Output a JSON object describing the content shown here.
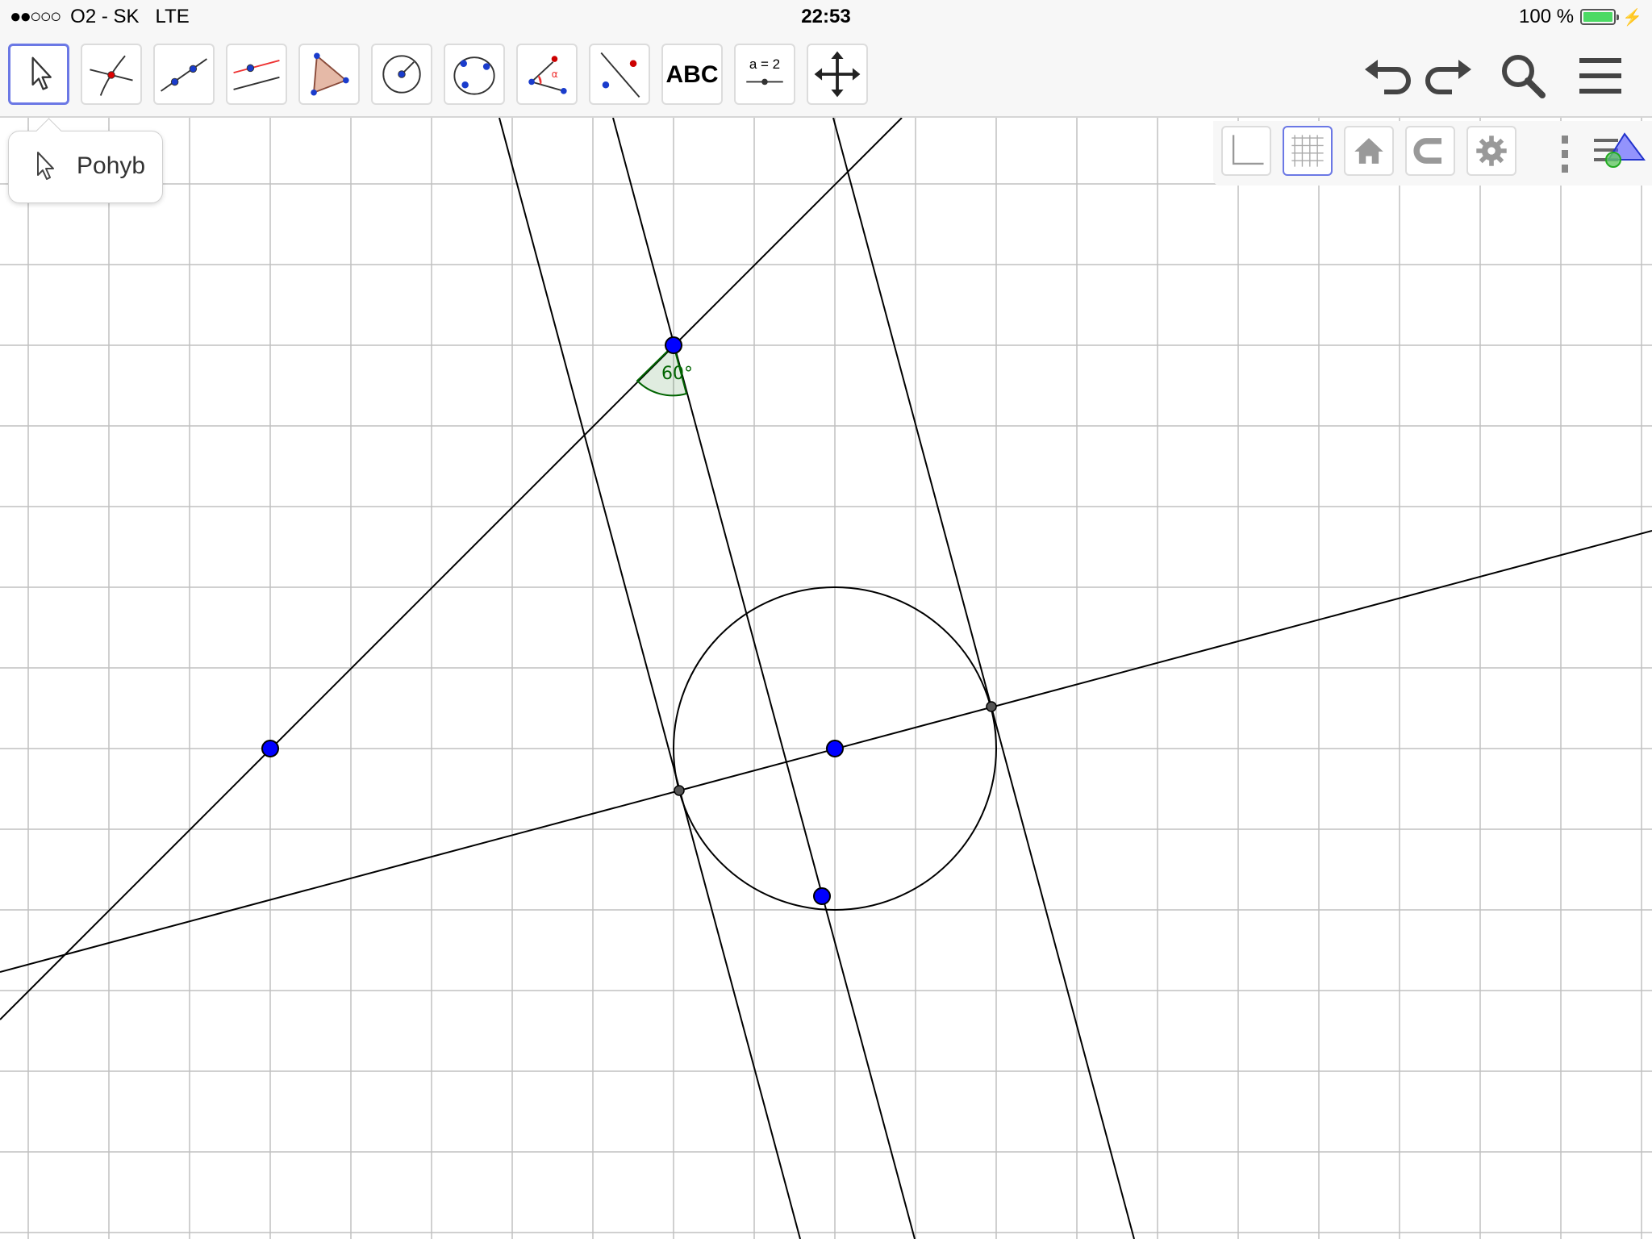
{
  "status_bar": {
    "carrier": "O2 - SK",
    "network": "LTE",
    "time": "22:53",
    "battery": "100 %"
  },
  "toolbar": {
    "tools": [
      {
        "id": "move",
        "icon": "move-arrow-icon",
        "active": true
      },
      {
        "id": "point",
        "icon": "point-on-intersection-icon"
      },
      {
        "id": "line",
        "icon": "line-through-points-icon"
      },
      {
        "id": "parallel",
        "icon": "parallel-line-icon"
      },
      {
        "id": "polygon",
        "icon": "polygon-icon"
      },
      {
        "id": "circle",
        "icon": "circle-center-point-icon"
      },
      {
        "id": "conic",
        "icon": "circle-three-points-icon"
      },
      {
        "id": "angle",
        "icon": "angle-icon"
      },
      {
        "id": "reflect",
        "icon": "reflect-about-line-icon"
      },
      {
        "id": "text",
        "icon": "text-icon",
        "label": "ABC"
      },
      {
        "id": "slider",
        "icon": "slider-icon",
        "label": "a = 2"
      },
      {
        "id": "move-view",
        "icon": "move-graphics-view-icon"
      }
    ],
    "right": [
      "undo-icon",
      "redo-icon",
      "search-icon",
      "menu-icon"
    ]
  },
  "tooltip": {
    "label": "Pohyb"
  },
  "view_toolbar": {
    "buttons": [
      "axes-icon",
      "grid-icon",
      "home-icon",
      "magnet-icon",
      "gear-icon"
    ],
    "grid_active": true
  },
  "construction": {
    "angle_label": "60°",
    "colors": {
      "point": "#0000ff",
      "intersection": "#555555",
      "line": "#000000",
      "angle": "#006400",
      "grid": "#c0c0c0"
    }
  }
}
